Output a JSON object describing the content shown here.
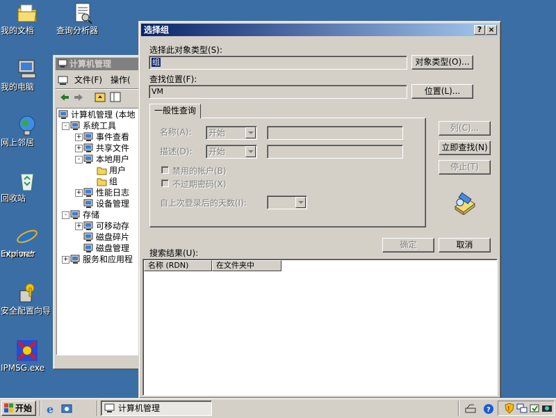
{
  "desktop": {
    "icons": [
      {
        "label": "我的文档",
        "icon": "my-documents-icon"
      },
      {
        "label": "查询分析器",
        "icon": "query-analyzer-icon"
      },
      {
        "label": "我的电脑",
        "icon": "my-computer-icon"
      },
      {
        "label": "网上邻居",
        "icon": "network-neighborhood-icon"
      },
      {
        "label": "回收站",
        "icon": "recycle-bin-icon"
      },
      {
        "label": "Internet",
        "label2": "Explorer",
        "icon": "internet-explorer-icon"
      },
      {
        "label": "安全配置向导",
        "icon": "security-wizard-icon"
      },
      {
        "label": "IPMSG.exe",
        "icon": "ipmsg-icon"
      }
    ],
    "background_color": "#3a6ea5"
  },
  "computer_management": {
    "title": "计算机管理",
    "menu": [
      "文件(F)",
      "操作("
    ],
    "tree": [
      {
        "label": "计算机管理 (本地",
        "level": 0,
        "toggle": ""
      },
      {
        "label": "系统工具",
        "level": 1,
        "toggle": "-"
      },
      {
        "label": "事件查看",
        "level": 2,
        "toggle": "+"
      },
      {
        "label": "共享文件",
        "level": 2,
        "toggle": "+"
      },
      {
        "label": "本地用户",
        "level": 2,
        "toggle": "-"
      },
      {
        "label": "用户",
        "level": 3,
        "toggle": ""
      },
      {
        "label": "组",
        "level": 3,
        "toggle": ""
      },
      {
        "label": "性能日志",
        "level": 2,
        "toggle": "+"
      },
      {
        "label": "设备管理",
        "level": 2,
        "toggle": ""
      },
      {
        "label": "存储",
        "level": 1,
        "toggle": "-"
      },
      {
        "label": "可移动存",
        "level": 2,
        "toggle": "+"
      },
      {
        "label": "磁盘碎片",
        "level": 2,
        "toggle": ""
      },
      {
        "label": "磁盘管理",
        "level": 2,
        "toggle": ""
      },
      {
        "label": "服务和应用程",
        "level": 1,
        "toggle": "+"
      }
    ]
  },
  "dialog": {
    "title": "选择组",
    "help_button": "?",
    "close_button": "×",
    "object_type_label": "选择此对象类型(S):",
    "object_type_value": "组",
    "object_type_button": "对象类型(O)...",
    "location_label": "查找位置(F):",
    "location_value": "VM",
    "location_button": "位置(L)...",
    "tab_label": "一般性查询",
    "name_label": "名称(A):",
    "name_op": "开始",
    "desc_label": "描述(D):",
    "desc_op": "开始",
    "disabled_accounts_label": "禁用的帐户(B)",
    "non_expiring_pw_label": "不过期密码(X)",
    "days_since_logon_label": "自上次登录后的天数(I):",
    "columns_button": "列(C)...",
    "find_now_button": "立即查找(N)",
    "stop_button": "停止(T)",
    "search_results_label": "搜索结果(U):",
    "ok_button": "确定",
    "cancel_button": "取消",
    "results_columns": [
      "名称 (RDN)",
      "在文件夹中"
    ]
  },
  "taskbar": {
    "start_label": "开始",
    "task_label": "计算机管理"
  }
}
